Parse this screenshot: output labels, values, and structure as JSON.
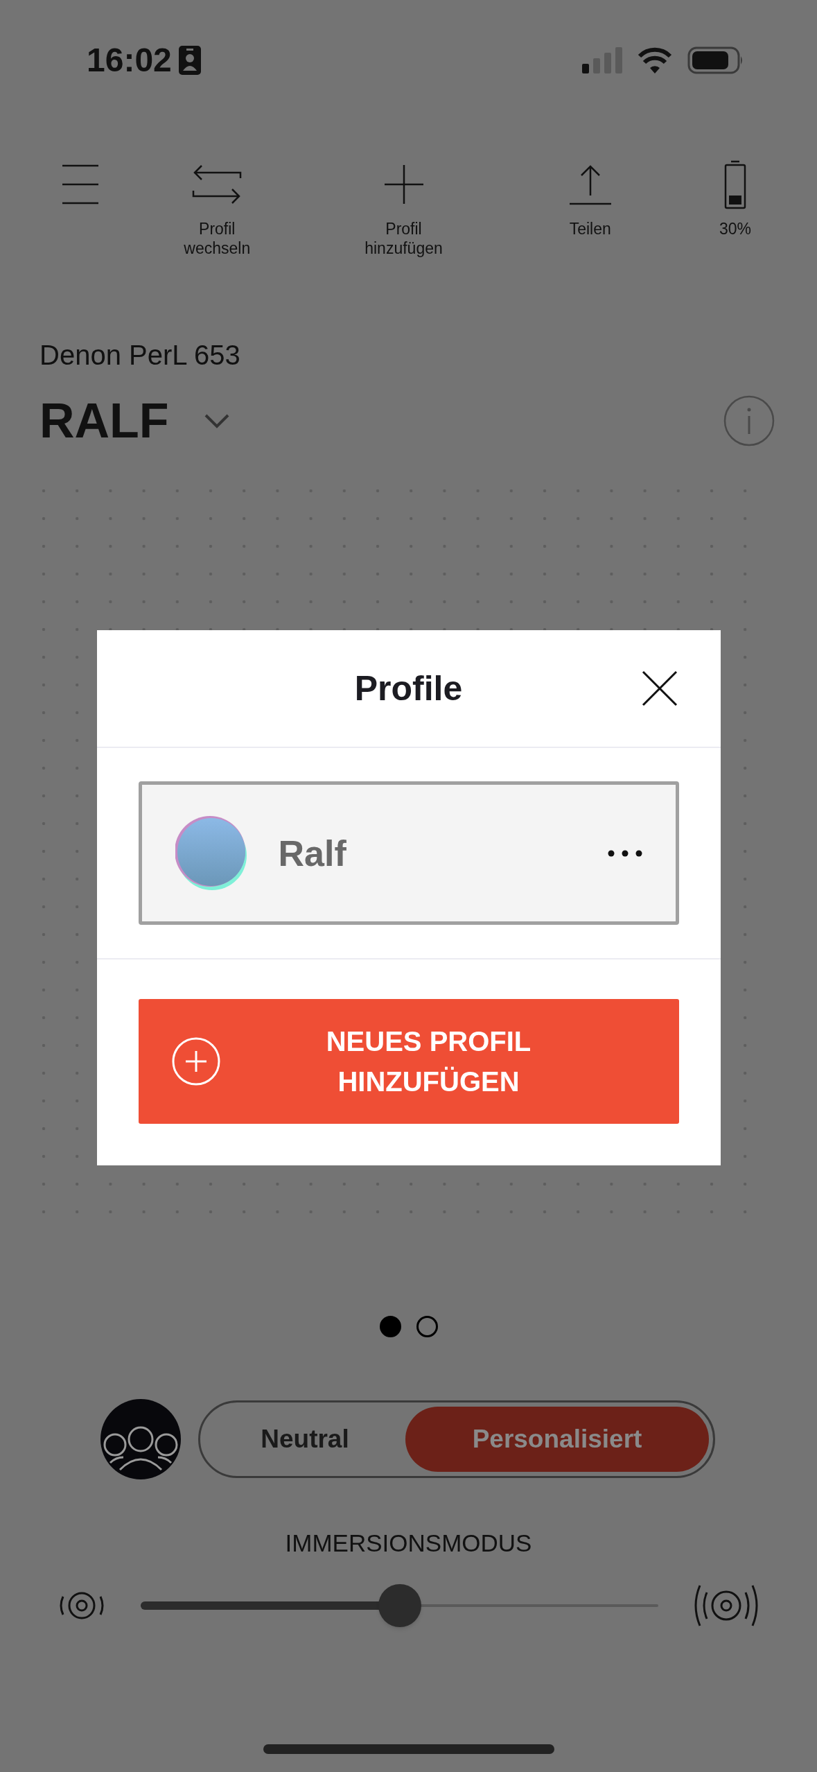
{
  "status_bar": {
    "time": "16:02"
  },
  "toolbar": [
    {
      "kind": "menu"
    },
    {
      "kind": "swap",
      "label": "Profil wechseln"
    },
    {
      "kind": "add",
      "label": "Profil hinzufügen"
    },
    {
      "kind": "share",
      "label": "Teilen"
    },
    {
      "kind": "battery",
      "label": "30%"
    }
  ],
  "device": {
    "model": "Denon PerL 653",
    "profile": "RALF"
  },
  "dialog": {
    "title": "Profile",
    "profiles": [
      {
        "name": "Ralf",
        "selected": true
      }
    ],
    "add_button": "NEUES PROFIL HINZUFÜGEN"
  },
  "pager": [
    {
      "selected": true
    },
    {
      "selected": false
    }
  ],
  "mode": [
    {
      "label": "Neutral",
      "selected": false
    },
    {
      "label": "Personalisiert",
      "selected": true
    }
  ],
  "immersion": {
    "label": "IMMERSIONSMODUS",
    "level": 0.5
  }
}
